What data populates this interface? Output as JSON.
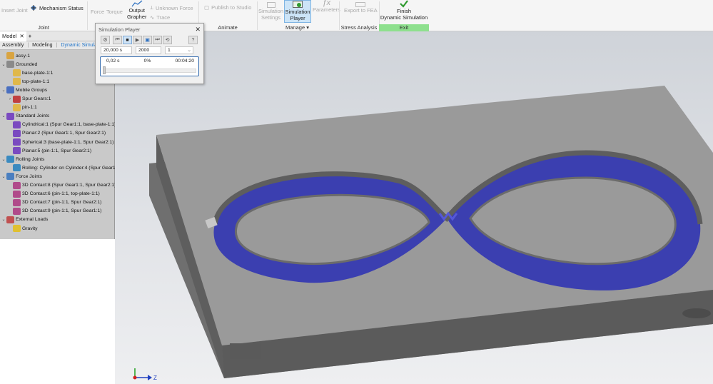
{
  "ribbon": {
    "insert_joint": "Insert Joint",
    "mechanism_status": "Mechanism Status",
    "force": "Force",
    "torque": "Torque",
    "output_grapher": "Output\nGrapher",
    "unknown_force": "Unknown Force",
    "trace": "Trace",
    "publish_to_studio": "Publish to Studio",
    "simulation_settings": "Simulation\nSettings",
    "simulation_player": "Simulation\nPlayer",
    "parameters": "Parameters",
    "export_to_fea": "Export to FEA",
    "finish_dynamic_simulation": "Finish\nDynamic Simulation",
    "panels": {
      "joint": "Joint",
      "animate": "Animate",
      "manage": "Manage ▾",
      "stress_analysis": "Stress Analysis",
      "exit": "Exit"
    },
    "colors": {
      "exit_bg": "#8ee08e",
      "active_btn": "#cce4f7"
    }
  },
  "browser": {
    "tabs": [
      "Model",
      "+"
    ],
    "sub_tabs": [
      "Assembly",
      "Modeling",
      "Dynamic Simulation"
    ],
    "tree": [
      {
        "label": "assy-1",
        "level": 0,
        "icon": "assembly-icon"
      },
      {
        "label": "Grounded",
        "level": 0,
        "icon": "grounded-icon",
        "twisty": "v"
      },
      {
        "label": "base-plate-1:1",
        "level": 1,
        "icon": "part-icon"
      },
      {
        "label": "top-plate-1:1",
        "level": 1,
        "icon": "part-icon"
      },
      {
        "label": "Mobile Groups",
        "level": 0,
        "icon": "mobile-groups-icon",
        "twisty": "v"
      },
      {
        "label": "Spur Gears:1",
        "level": 1,
        "icon": "gear-icon",
        "twisty": ">"
      },
      {
        "label": "pin-1:1",
        "level": 1,
        "icon": "part-icon"
      },
      {
        "label": "Standard Joints",
        "level": 0,
        "icon": "joint-icon",
        "twisty": "v"
      },
      {
        "label": "Cylindrical:1 (Spur Gear1:1, base-plate-1:1)",
        "level": 1,
        "icon": "joint-icon"
      },
      {
        "label": "Planar:2 (Spur Gear1:1, Spur Gear2:1)",
        "level": 1,
        "icon": "joint-icon"
      },
      {
        "label": "Spherical:3 (base-plate-1:1, Spur Gear2:1)",
        "level": 1,
        "icon": "joint-icon"
      },
      {
        "label": "Planar:5 (pin-1:1, Spur Gear2:1)",
        "level": 1,
        "icon": "joint-icon"
      },
      {
        "label": "Rolling Joints",
        "level": 0,
        "icon": "rolling-icon",
        "twisty": "v"
      },
      {
        "label": "Rolling: Cylinder on Cylinder:4 (Spur Gear1:1",
        "level": 1,
        "icon": "rolling-icon"
      },
      {
        "label": "Force Joints",
        "level": 0,
        "icon": "force-joint-icon",
        "twisty": "v"
      },
      {
        "label": "3D Contact:8 (Spur Gear1:1, Spur Gear2:1)",
        "level": 1,
        "icon": "contact-icon"
      },
      {
        "label": "3D Contact:6 (pin-1:1, top-plate-1:1)",
        "level": 1,
        "icon": "contact-icon"
      },
      {
        "label": "3D Contact:7 (pin-1:1, Spur Gear2:1)",
        "level": 1,
        "icon": "contact-icon"
      },
      {
        "label": "3D Contact:9 (pin-1:1, Spur Gear1:1)",
        "level": 1,
        "icon": "contact-icon"
      },
      {
        "label": "External Loads",
        "level": 0,
        "icon": "loads-icon",
        "twisty": "v"
      },
      {
        "label": "Gravity",
        "level": 1,
        "icon": "gravity-icon"
      }
    ]
  },
  "player": {
    "title": "Simulation Player",
    "close": "✕",
    "end_time": "20,000 s",
    "images": "2000",
    "filter": "1",
    "current_time": "0,02 s",
    "percent": "0%",
    "elapsed": "00:04:20",
    "progress_fraction": 0.0
  },
  "viewport": {
    "axis_z": "Z",
    "colors": {
      "plate": "#8e8e8e",
      "channel": "#3b3fb0",
      "gear": "#4a4fd0"
    }
  }
}
